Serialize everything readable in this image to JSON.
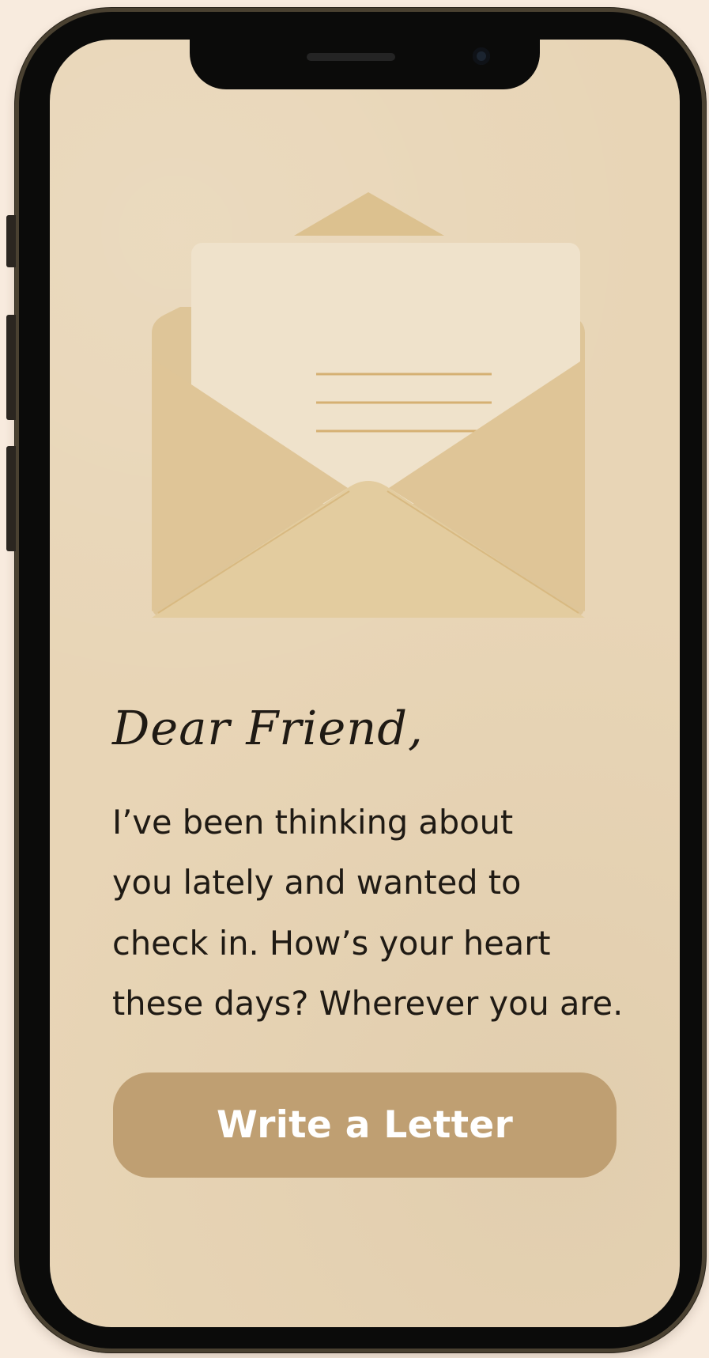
{
  "letter": {
    "salutation": "Dear Friend,",
    "body": "I’ve been thinking about\nyou lately and wanted to\ncheck in. How’s your heart\nthese days? Wherever you are."
  },
  "actions": {
    "write_label": "Write a Letter"
  },
  "icons": {
    "illustration": "open-envelope-with-letter-icon"
  },
  "colors": {
    "background": "#f8ebde",
    "screen": "#e8d5b6",
    "envelope": "#dfc699",
    "paper": "#efe2cb",
    "accent": "#bf9f72",
    "text": "#1f1a14"
  }
}
